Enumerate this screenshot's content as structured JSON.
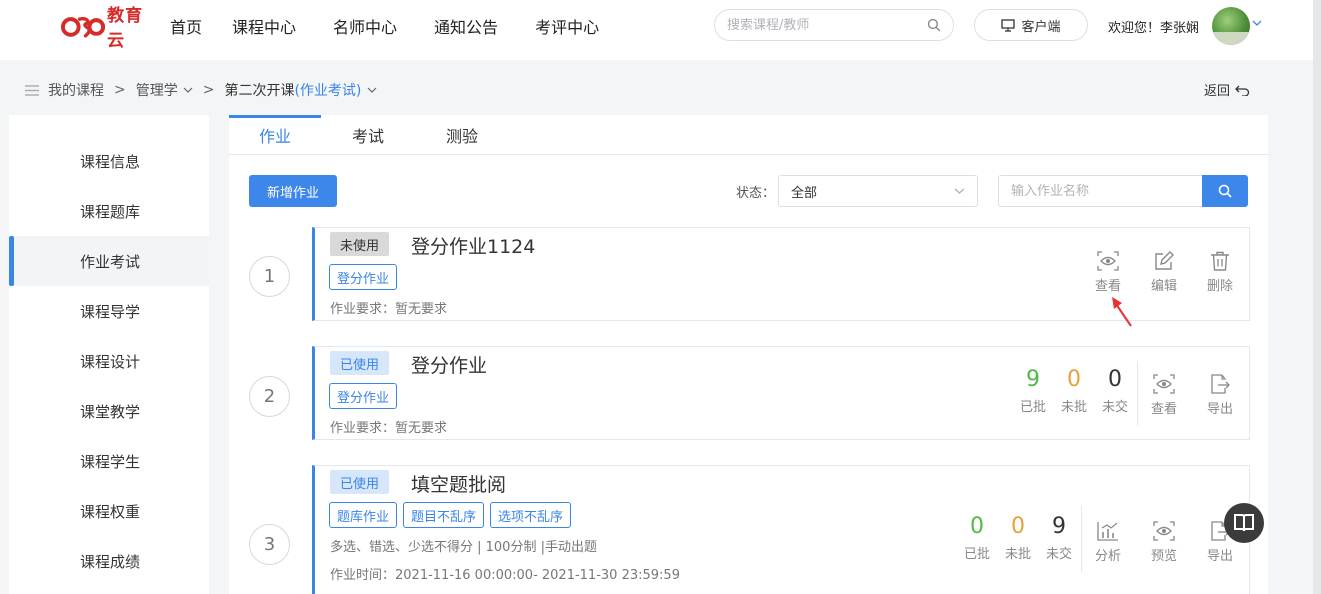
{
  "header": {
    "logo_text": "教育云",
    "nav": [
      "首页",
      "课程中心",
      "名师中心",
      "通知公告",
      "考评中心"
    ],
    "search_placeholder": "搜索课程/教师",
    "client_label": "客户端",
    "welcome": "欢迎您！李张娴"
  },
  "breadcrumb": {
    "root": "我的课程",
    "course": "管理学",
    "class_name": "第二次开课",
    "section": "(作业考试)",
    "back": "返回"
  },
  "sidebar": {
    "items": [
      "课程信息",
      "课程题库",
      "作业考试",
      "课程导学",
      "课程设计",
      "课堂教学",
      "课程学生",
      "课程权重",
      "课程成绩"
    ],
    "active_index": 2
  },
  "tabs": [
    "作业",
    "考试",
    "测验"
  ],
  "toolbar": {
    "add_label": "新增作业",
    "status_label": "状态：",
    "status_value": "全部",
    "name_placeholder": "输入作业名称"
  },
  "assignments": [
    {
      "index": "1",
      "status": "未使用",
      "title": "登分作业1124",
      "tags": [
        "登分作业"
      ],
      "desc": "作业要求：暂无要求",
      "actions": [
        "查看",
        "编辑",
        "删除"
      ]
    },
    {
      "index": "2",
      "status": "已使用",
      "title": "登分作业",
      "tags": [
        "登分作业"
      ],
      "desc": "作业要求：暂无要求",
      "stats": [
        {
          "value": "9",
          "label": "已批",
          "color": "#52b84a"
        },
        {
          "value": "0",
          "label": "未批",
          "color": "#e6a23c"
        },
        {
          "value": "0",
          "label": "未交",
          "color": "#333333"
        }
      ],
      "actions": [
        "查看",
        "导出"
      ]
    },
    {
      "index": "3",
      "status": "已使用",
      "title": "填空题批阅",
      "tags": [
        "题库作业",
        "题目不乱序",
        "选项不乱序"
      ],
      "desc": "多选、错选、少选不得分 | 100分制 |手动出题",
      "time": "作业时间：2021-11-16 00:00:00- 2021-11-30 23:59:59",
      "stats": [
        {
          "value": "0",
          "label": "已批",
          "color": "#52b84a"
        },
        {
          "value": "0",
          "label": "未批",
          "color": "#e6a23c"
        },
        {
          "value": "9",
          "label": "未交",
          "color": "#333333"
        }
      ],
      "actions": [
        "分析",
        "预览",
        "导出"
      ]
    }
  ],
  "colors": {
    "accent": "#3a85e6",
    "logo_red": "#d62b2b",
    "annotation_arrow": "#e8322f"
  }
}
